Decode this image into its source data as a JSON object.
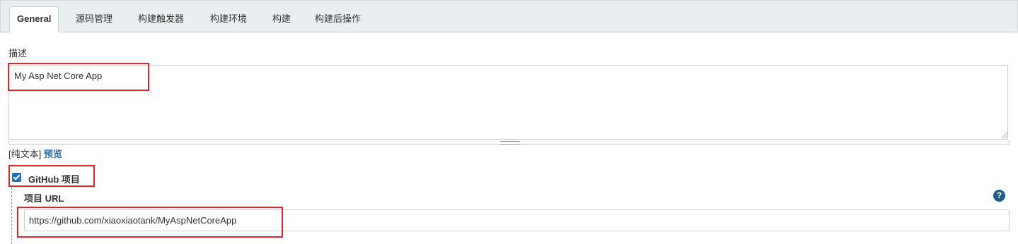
{
  "tabs": [
    {
      "label": "General"
    },
    {
      "label": "源码管理"
    },
    {
      "label": "构建触发器"
    },
    {
      "label": "构建环境"
    },
    {
      "label": "构建"
    },
    {
      "label": "构建后操作"
    }
  ],
  "description": {
    "label": "描述",
    "value": "My Asp Net Core App",
    "format_plain": "[纯文本]",
    "format_preview": "预览"
  },
  "github_project": {
    "checked": true,
    "label": "GitHub 项目",
    "url_label": "项目 URL",
    "url_value": "https://github.com/xiaoxiaotank/MyAspNetCoreApp",
    "help_icon": "question-circle-icon"
  },
  "colors": {
    "highlight_box": "#e0262a",
    "link": "#2a6fb0",
    "checkbox": "#1a73c9"
  }
}
